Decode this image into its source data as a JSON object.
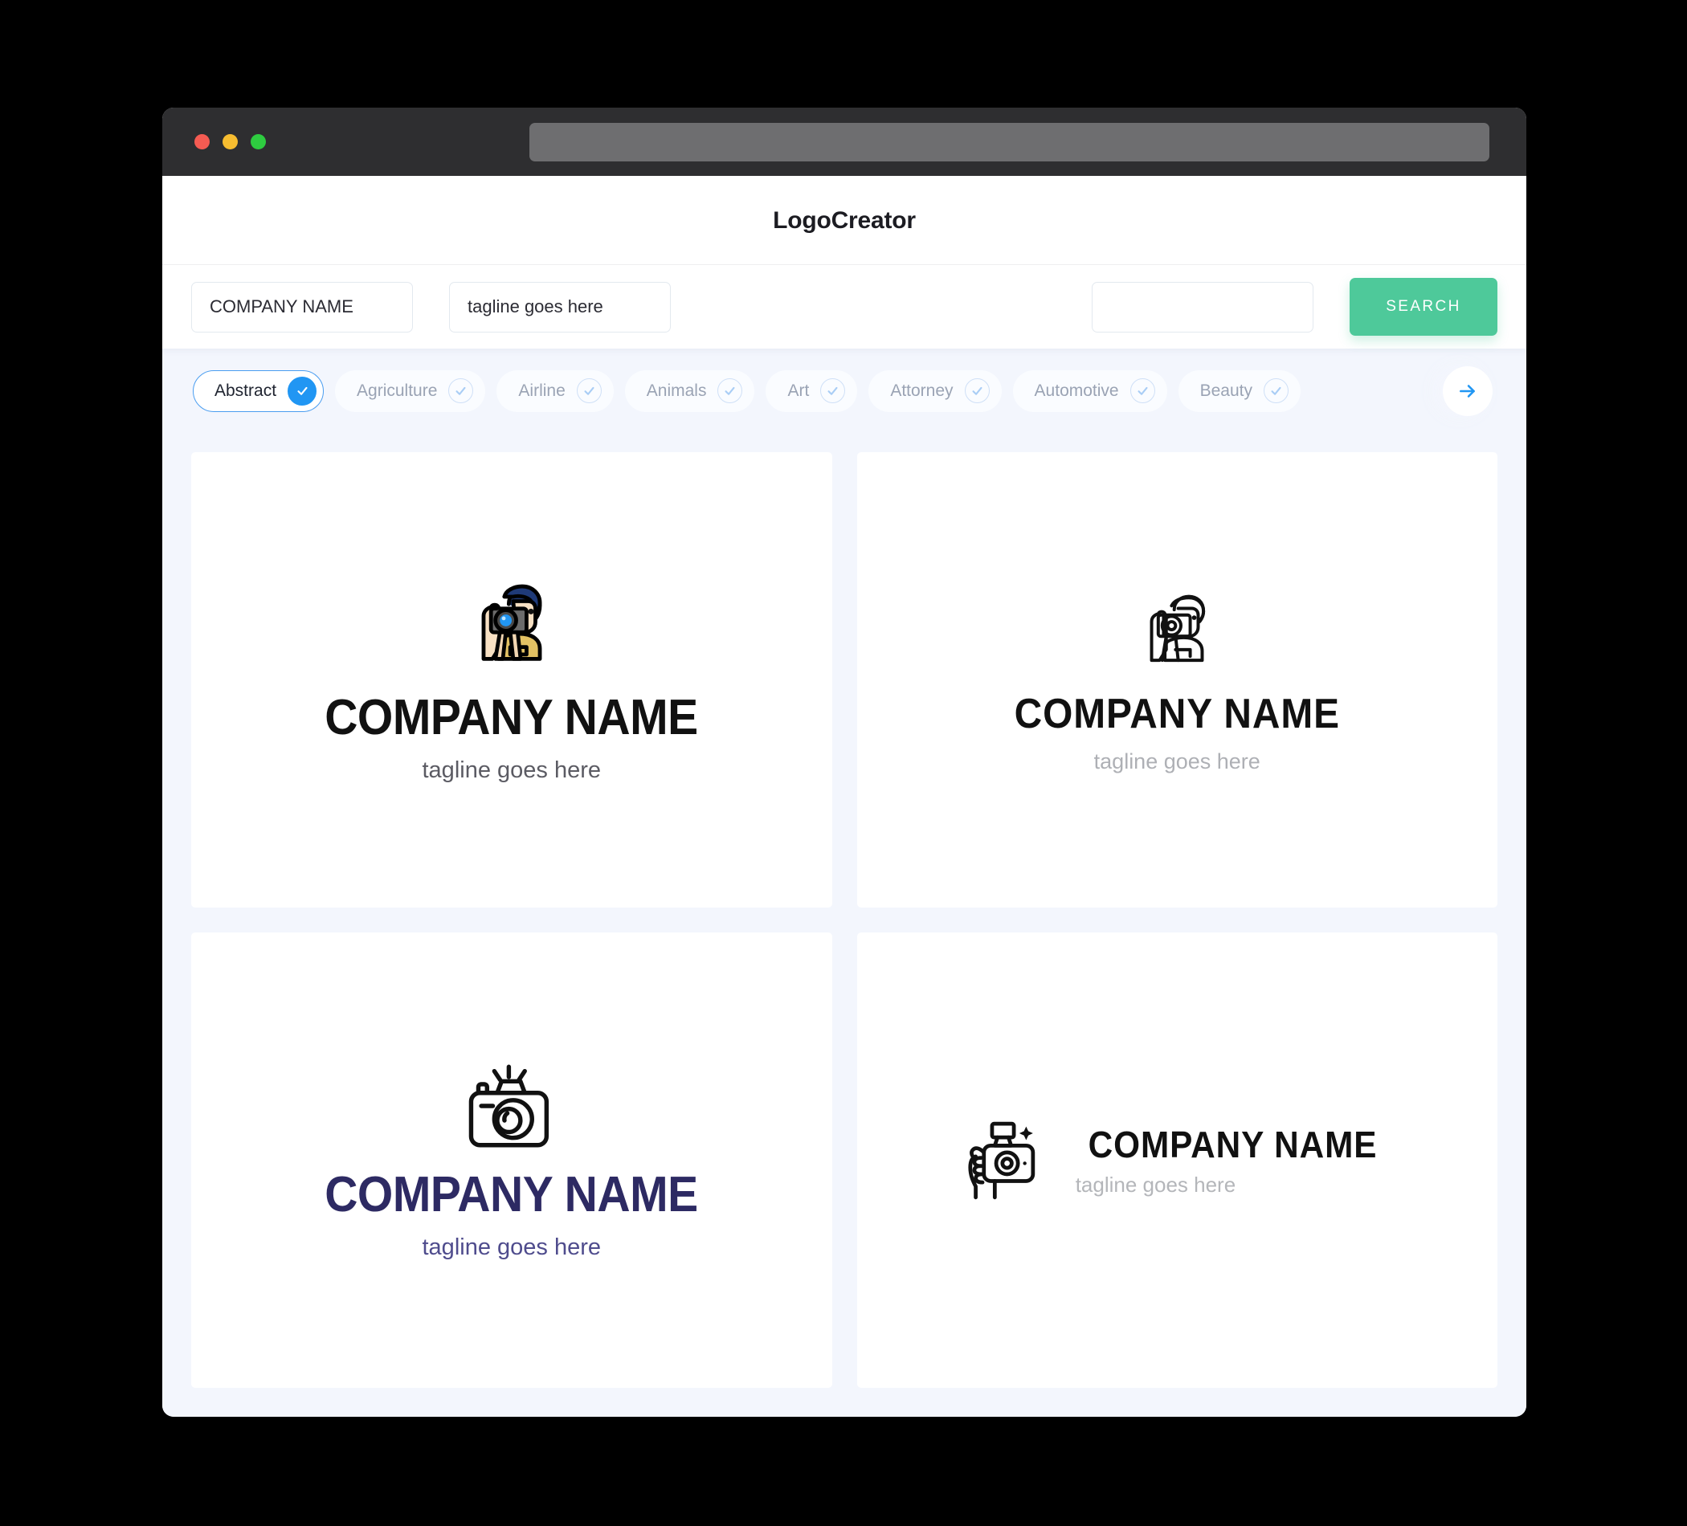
{
  "window": {
    "traffic_lights": [
      "close",
      "minimize",
      "maximize"
    ],
    "url_value": ""
  },
  "header": {
    "title": "LogoCreator"
  },
  "search": {
    "company_value": "COMPANY NAME",
    "company_placeholder": "COMPANY NAME",
    "tagline_value": "tagline goes here",
    "tagline_placeholder": "tagline goes here",
    "extra_value": "",
    "extra_placeholder": "",
    "button_label": "SEARCH",
    "button_color": "#4ec99a"
  },
  "categories": {
    "next_icon": "arrow-right-icon",
    "selected_color": "#2196f3",
    "items": [
      {
        "label": "Abstract",
        "selected": true
      },
      {
        "label": "Agriculture",
        "selected": false
      },
      {
        "label": "Airline",
        "selected": false
      },
      {
        "label": "Animals",
        "selected": false
      },
      {
        "label": "Art",
        "selected": false
      },
      {
        "label": "Attorney",
        "selected": false
      },
      {
        "label": "Automotive",
        "selected": false
      },
      {
        "label": "Beauty",
        "selected": false
      }
    ]
  },
  "results": {
    "cards": [
      {
        "id": "logo-card-1",
        "icon": "photographer-color-icon",
        "layout": "stacked",
        "name": "COMPANY NAME",
        "tagline": "tagline goes here",
        "name_color": "#111111",
        "tagline_color": "#5b5b63"
      },
      {
        "id": "logo-card-2",
        "icon": "photographer-outline-icon",
        "layout": "stacked",
        "name": "COMPANY NAME",
        "tagline": "tagline goes here",
        "name_color": "#111111",
        "tagline_color": "#aeb0b5"
      },
      {
        "id": "logo-card-3",
        "icon": "camera-flash-icon",
        "layout": "stacked",
        "name": "COMPANY NAME",
        "tagline": "tagline goes here",
        "name_color": "#2d2a63",
        "tagline_color": "#4f4c8d"
      },
      {
        "id": "logo-card-4",
        "icon": "hand-camera-icon",
        "layout": "horizontal",
        "name": "COMPANY NAME",
        "tagline": "tagline goes here",
        "name_color": "#111111",
        "tagline_color": "#b4b6ba"
      }
    ]
  }
}
